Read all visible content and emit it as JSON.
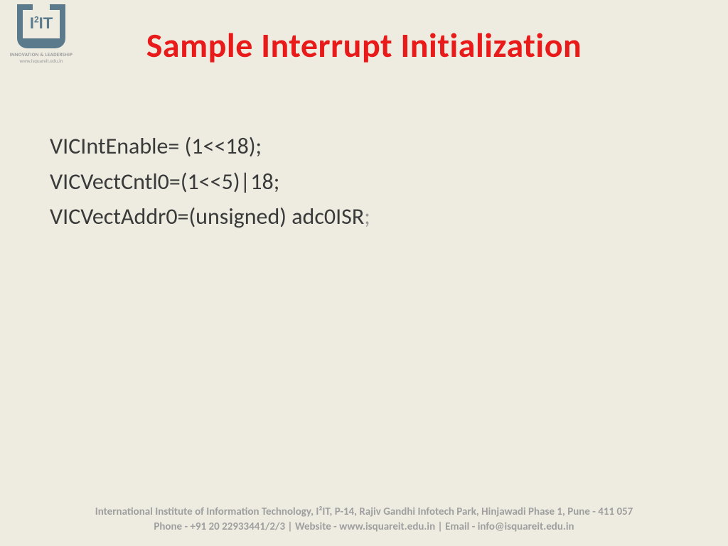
{
  "logo": {
    "text_prefix": "I",
    "text_super": "2",
    "text_suffix": "IT",
    "tagline": "INNOVATION & LEADERSHIP",
    "url": "www.isquareit.edu.in"
  },
  "title": "Sample Interrupt Initialization",
  "code": {
    "line1": "VICIntEnable= (1<<18);",
    "line2": "VICVectCntl0=(1<<5)|18;",
    "line3_main": "VICVectAddr0=(unsigned) adc0ISR",
    "line3_semi": ";"
  },
  "footer": {
    "line1": "International Institute of Information Technology, I²IT, P-14, Rajiv Gandhi Infotech Park, Hinjawadi Phase 1, Pune - 411 057",
    "line2": "Phone - +91 20 22933441/2/3 | Website - www.isquareit.edu.in | Email - info@isquareit.edu.in"
  }
}
